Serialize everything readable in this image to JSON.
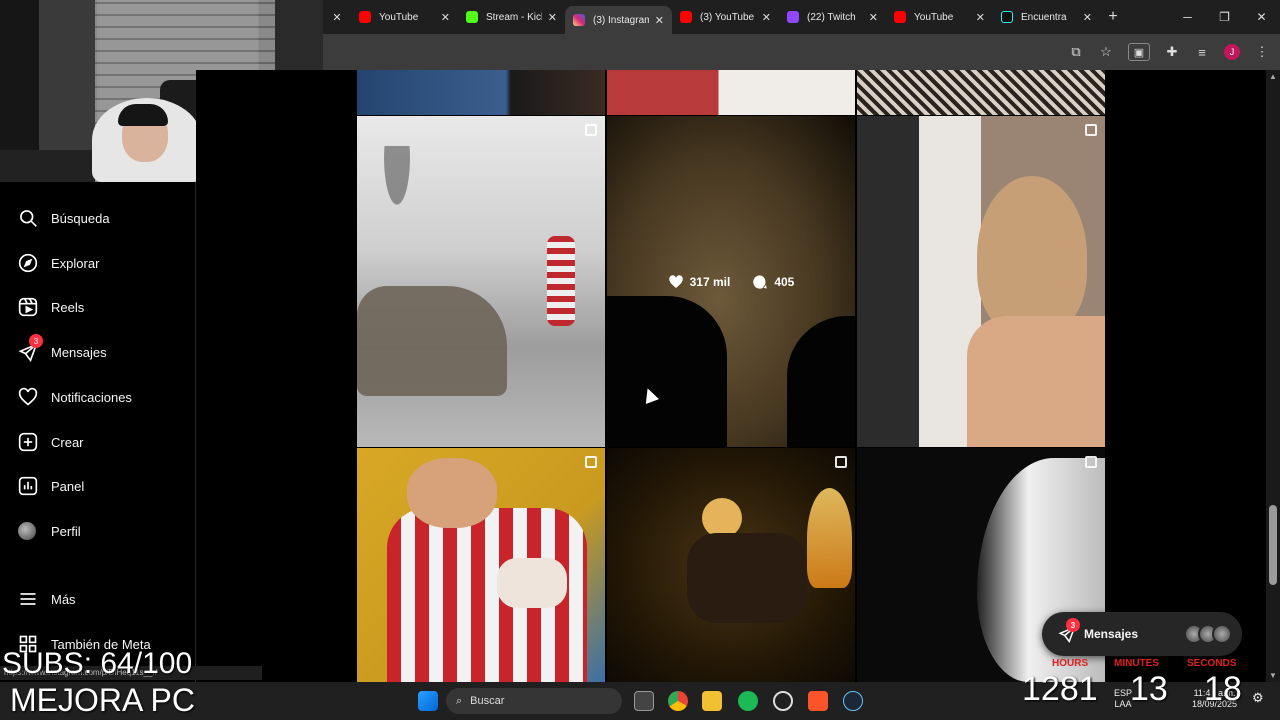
{
  "browser": {
    "tabs": [
      {
        "label": "YouTube",
        "color": "#ff0000",
        "active": false
      },
      {
        "label": "Stream - Kick",
        "color": "#53fc18",
        "active": false
      },
      {
        "label": "(3) Instagram",
        "color": "#e1306c",
        "active": true
      },
      {
        "label": "(3) YouTube",
        "color": "#ff0000",
        "active": false
      },
      {
        "label": "(22) Twitch",
        "color": "#9146ff",
        "active": false
      },
      {
        "label": "YouTube",
        "color": "#ff0000",
        "active": false
      },
      {
        "label": "Encuentra",
        "color": "#000000",
        "active": false
      }
    ],
    "new_tab": "+",
    "profile_initial": "J"
  },
  "sidebar": {
    "items": [
      {
        "label": "Búsqueda",
        "icon": "search-icon"
      },
      {
        "label": "Explorar",
        "icon": "compass-icon"
      },
      {
        "label": "Reels",
        "icon": "reels-icon"
      },
      {
        "label": "Mensajes",
        "icon": "messenger-icon",
        "badge": "3"
      },
      {
        "label": "Notificaciones",
        "icon": "heart-icon"
      },
      {
        "label": "Crear",
        "icon": "plus-square-icon"
      },
      {
        "label": "Panel",
        "icon": "chart-icon"
      },
      {
        "label": "Perfil",
        "icon": "avatar"
      },
      {
        "label": "Más",
        "icon": "menu-icon"
      },
      {
        "label": "También de Meta",
        "icon": "meta-icon"
      }
    ]
  },
  "grid": {
    "hovered_likes": "317 mil",
    "hovered_comments": "405"
  },
  "messages_pill": {
    "label": "Mensajes",
    "badge": "3"
  },
  "status_url": "https://www.instagram.com/p/DIHeq11s__r/",
  "overlay": {
    "subs": "SUBS: 64/100",
    "brand": "MEJORA PC",
    "hours_label": "HOURS",
    "minutes_label": "MINUTES",
    "seconds_label": "SECONDS",
    "hours": "1281",
    "minutes": "13",
    "seconds": "18"
  },
  "taskbar": {
    "search_placeholder": "Buscar",
    "lang_top": "ESP",
    "lang_bottom": "LAA",
    "time": "11:4_ a.m.",
    "date": "18/09/2025"
  }
}
